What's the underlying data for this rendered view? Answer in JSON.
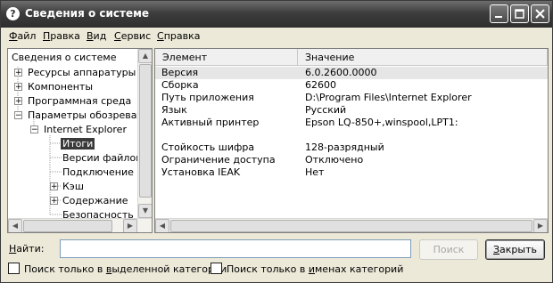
{
  "window": {
    "title": "Сведения о системе",
    "icon": "help-question-icon"
  },
  "menu": [
    {
      "mnemonic": "Ф",
      "rest": "айл"
    },
    {
      "mnemonic": "П",
      "rest": "равка"
    },
    {
      "mnemonic": "В",
      "rest": "ид"
    },
    {
      "mnemonic": "С",
      "rest": "ервис"
    },
    {
      "mnemonic": "С",
      "rest": "правка"
    }
  ],
  "tree": {
    "root": "Сведения о системе",
    "items": [
      "Ресурсы аппаратуры",
      "Компоненты",
      "Программная среда",
      "Параметры обозревате",
      "Internet Explorer",
      "Итоги",
      "Версии файлов",
      "Подключение",
      "Кэш",
      "Содержание",
      "Безопасность"
    ]
  },
  "table": {
    "columns": [
      "Элемент",
      "Значение"
    ],
    "rows": [
      [
        "Версия",
        "6.0.2600.0000"
      ],
      [
        "Сборка",
        "62600"
      ],
      [
        "Путь приложения",
        "D:\\Program Files\\Internet Explorer"
      ],
      [
        "Язык",
        "Русский"
      ],
      [
        "Активный принтер",
        "Epson LQ-850+,winspool,LPT1:"
      ],
      [
        "",
        ""
      ],
      [
        "Стойкость шифра",
        "128-разрядный"
      ],
      [
        "Ограничение доступа",
        "Отключено"
      ],
      [
        "Установка IEAK",
        "Нет"
      ]
    ]
  },
  "find": {
    "label_mnemonic": "Н",
    "label_rest": "айти:",
    "value": ""
  },
  "buttons": {
    "search": "Поиск",
    "close_mnemonic": "З",
    "close_rest": "акрыть"
  },
  "checkboxes": [
    {
      "before": "Поиск только в ",
      "mnemonic": "в",
      "after": "ыделенной категории",
      "checked": false
    },
    {
      "before": "Поиск только в ",
      "mnemonic": "и",
      "after": "менах категорий",
      "checked": false
    }
  ]
}
